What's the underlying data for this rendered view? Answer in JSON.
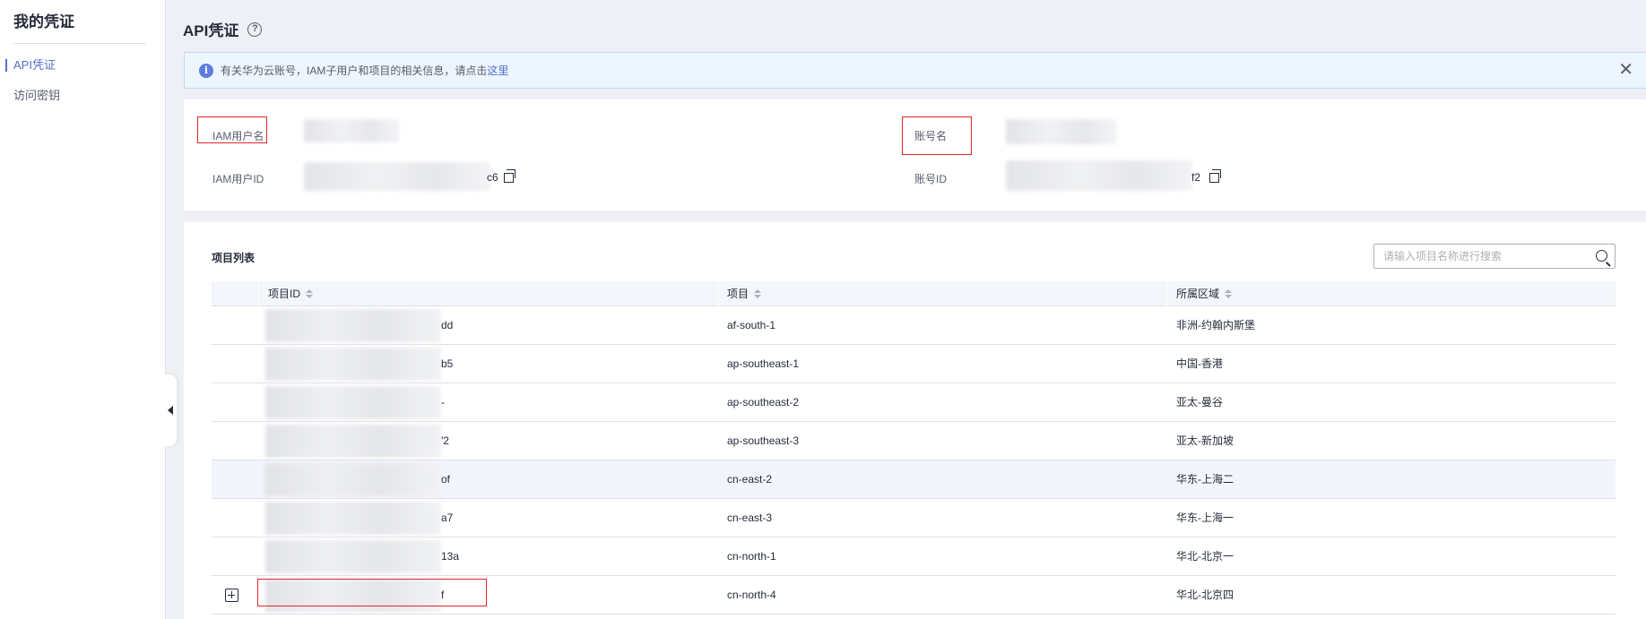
{
  "sidebar": {
    "title": "我的凭证",
    "items": [
      {
        "label": "API凭证",
        "active": true
      },
      {
        "label": "访问密钥",
        "active": false
      }
    ]
  },
  "header": {
    "title": "API凭证",
    "help_icon": "question-circle-icon",
    "help_glyph": "?"
  },
  "notice": {
    "icon": "info-icon",
    "icon_glyph": "i",
    "text": "有关华为云账号，IAM子用户和项目的相关信息，请点击",
    "link_text": "这里",
    "close_glyph": "✕"
  },
  "account_info": {
    "iam_username_label": "IAM用户名",
    "iam_user_id_label": "IAM用户ID",
    "iam_user_id_tail": "c6",
    "account_name_label": "账号名",
    "account_id_label": "账号ID",
    "account_id_tail": "f2"
  },
  "projects": {
    "title": "项目列表",
    "search_placeholder": "请输入项目名称进行搜索",
    "columns": [
      "项目ID",
      "项目",
      "所属区域"
    ],
    "rows": [
      {
        "id_tail": "dd",
        "project": "af-south-1",
        "region": "非洲-约翰内斯堡"
      },
      {
        "id_tail": "b5",
        "project": "ap-southeast-1",
        "region": "中国-香港"
      },
      {
        "id_tail": "-",
        "project": "ap-southeast-2",
        "region": "亚太-曼谷"
      },
      {
        "id_tail": "'2",
        "project": "ap-southeast-3",
        "region": "亚太-新加坡"
      },
      {
        "id_tail": "of",
        "project": "cn-east-2",
        "region": "华东-上海二"
      },
      {
        "id_tail": "a7",
        "project": "cn-east-3",
        "region": "华东-上海一"
      },
      {
        "id_tail": "13a",
        "project": "cn-north-1",
        "region": "华北-北京一"
      },
      {
        "id_tail": "f",
        "project": "cn-north-4",
        "region": "华北-北京四"
      }
    ]
  },
  "colors": {
    "accent": "#526ecc",
    "highlight_box": "#e0252d",
    "notice_bg": "#edf5fd"
  }
}
